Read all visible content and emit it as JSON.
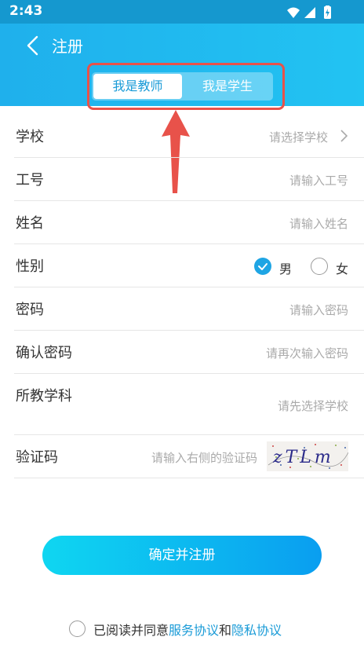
{
  "status_bar": {
    "time": "2:43"
  },
  "nav": {
    "title": "注册"
  },
  "role_tabs": {
    "teacher": "我是教师",
    "student": "我是学生",
    "selected": "teacher"
  },
  "form": {
    "school": {
      "label": "学校",
      "hint": "请选择学校"
    },
    "job_no": {
      "label": "工号",
      "hint": "请输入工号"
    },
    "name": {
      "label": "姓名",
      "hint": "请输入姓名"
    },
    "gender": {
      "label": "性别",
      "male": "男",
      "female": "女",
      "selected": "male"
    },
    "password": {
      "label": "密码",
      "hint": "请输入密码"
    },
    "confirm": {
      "label": "确认密码",
      "hint": "请再次输入密码"
    },
    "subject": {
      "label": "所教学科",
      "hint": "请先选择学校"
    },
    "captcha": {
      "label": "验证码",
      "hint": "请输入右侧的验证码",
      "code_text": "zTLm"
    }
  },
  "submit": {
    "label": "确定并注册"
  },
  "agreement": {
    "prefix": "已阅读并同意",
    "service": "服务协议",
    "and": "和",
    "privacy": "隐私协议"
  },
  "colors": {
    "brand": "#1fb0ec",
    "link": "#1a9bd7",
    "annotation": "#e8524a"
  }
}
